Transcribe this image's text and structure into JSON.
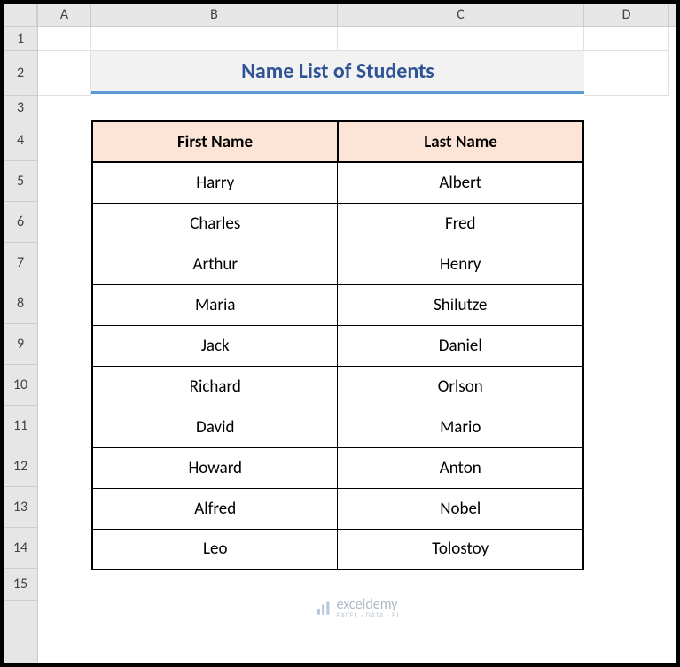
{
  "columns": [
    "A",
    "B",
    "C",
    "D"
  ],
  "rows": [
    "1",
    "2",
    "3",
    "4",
    "5",
    "6",
    "7",
    "8",
    "9",
    "10",
    "11",
    "12",
    "13",
    "14",
    "15"
  ],
  "title": "Name List of Students",
  "headers": {
    "col1": "First Name",
    "col2": "Last Name"
  },
  "data": [
    {
      "first": "Harry",
      "last": "Albert"
    },
    {
      "first": "Charles",
      "last": "Fred"
    },
    {
      "first": "Arthur",
      "last": "Henry"
    },
    {
      "first": "Maria",
      "last": "Shilutze"
    },
    {
      "first": "Jack",
      "last": "Daniel"
    },
    {
      "first": "Richard",
      "last": "Orlson"
    },
    {
      "first": "David",
      "last": "Mario"
    },
    {
      "first": "Howard",
      "last": "Anton"
    },
    {
      "first": "Alfred",
      "last": "Nobel"
    },
    {
      "first": "Leo",
      "last": "Tolostoy"
    }
  ],
  "watermark": {
    "brand": "exceldemy",
    "tagline": "EXCEL · DATA · BI"
  }
}
